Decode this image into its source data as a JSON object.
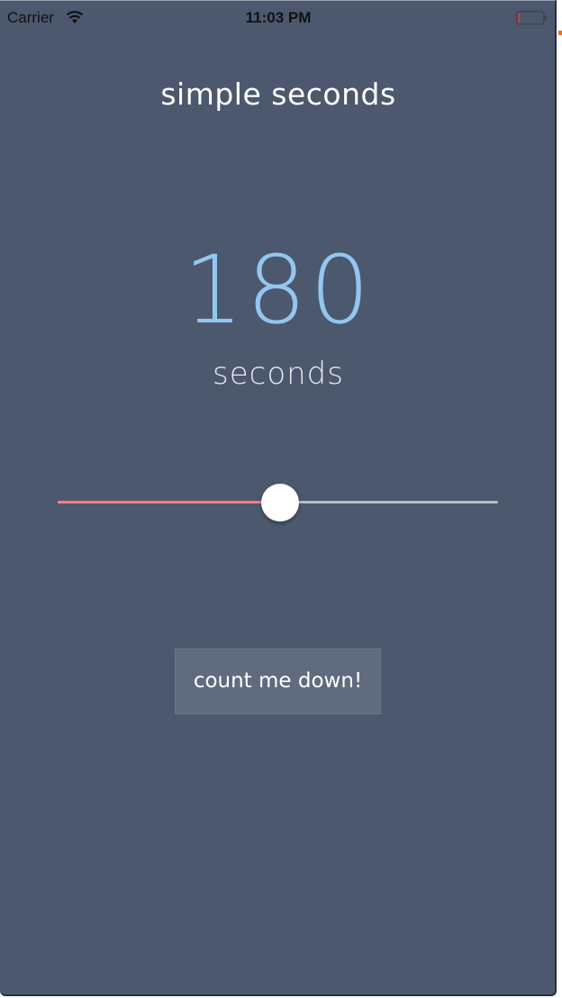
{
  "status_bar": {
    "carrier": "Carrier",
    "time": "11:03 PM",
    "wifi_icon": "wifi-icon",
    "battery_icon": "battery-low-icon",
    "battery_level": 0.06
  },
  "app": {
    "title": "simple seconds"
  },
  "timer": {
    "value": "180",
    "unit_label": "seconds"
  },
  "slider": {
    "value": 180,
    "fraction": 0.5,
    "fill_color": "#ee7f82",
    "track_color": "#b9bbbf"
  },
  "actions": {
    "count_down_label": "count me down!"
  },
  "colors": {
    "background": "#4b586e",
    "value_color": "#93c6f0",
    "button_bg": "#5f6b7e"
  }
}
